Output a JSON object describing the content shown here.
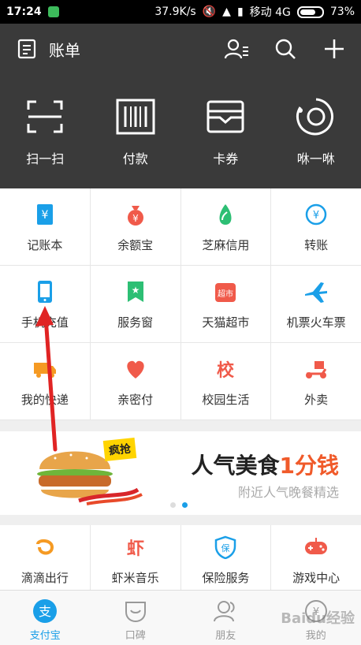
{
  "status": {
    "time": "17:24",
    "speed": "37.9K/s",
    "carrier": "移动 4G",
    "battery": "73%",
    "battery_level": 0.73
  },
  "header": {
    "title": "账单"
  },
  "quick_actions": [
    {
      "label": "扫一扫",
      "icon": "scan-icon"
    },
    {
      "label": "付款",
      "icon": "barcode-icon"
    },
    {
      "label": "卡券",
      "icon": "card-icon"
    },
    {
      "label": "咻一咻",
      "icon": "xiu-icon"
    }
  ],
  "grid_items": [
    {
      "label": "记账本",
      "icon": "ledger-icon",
      "color": "#1a9fe8"
    },
    {
      "label": "余额宝",
      "icon": "money-bag-icon",
      "color": "#f05a4a"
    },
    {
      "label": "芝麻信用",
      "icon": "sesame-icon",
      "color": "#2dbf74"
    },
    {
      "label": "转账",
      "icon": "transfer-icon",
      "color": "#1a9fe8"
    },
    {
      "label": "手机充值",
      "icon": "phone-icon",
      "color": "#1a9fe8"
    },
    {
      "label": "服务窗",
      "icon": "service-icon",
      "color": "#2dbf74"
    },
    {
      "label": "天猫超市",
      "icon": "tmall-icon",
      "color": "#f05a4a"
    },
    {
      "label": "机票火车票",
      "icon": "plane-icon",
      "color": "#1a9fe8"
    },
    {
      "label": "我的快递",
      "icon": "truck-icon",
      "color": "#f59a23"
    },
    {
      "label": "亲密付",
      "icon": "heart-icon",
      "color": "#f05a4a"
    },
    {
      "label": "校园生活",
      "icon": "campus-icon",
      "color": "#f05a4a"
    },
    {
      "label": "外卖",
      "icon": "scooter-icon",
      "color": "#f05a4a"
    }
  ],
  "banner": {
    "tag": "疯抢",
    "headline_main": "人气美食",
    "headline_accent": "1分钱",
    "subtitle": "附近人气晚餐精选"
  },
  "grid_items_2": [
    {
      "label": "滴滴出行",
      "icon": "didi-icon",
      "color": "#f59a23"
    },
    {
      "label": "虾米音乐",
      "icon": "shrimp-icon",
      "color": "#f05a4a"
    },
    {
      "label": "保险服务",
      "icon": "insurance-icon",
      "color": "#1a9fe8"
    },
    {
      "label": "游戏中心",
      "icon": "gamepad-icon",
      "color": "#f05a4a"
    }
  ],
  "tabs": [
    {
      "label": "支付宝",
      "icon": "alipay-icon",
      "active": true
    },
    {
      "label": "口碑",
      "icon": "koubei-icon",
      "active": false
    },
    {
      "label": "朋友",
      "icon": "friends-icon",
      "active": false
    },
    {
      "label": "我的",
      "icon": "me-icon",
      "active": false
    }
  ],
  "watermark": "Baidu经验"
}
